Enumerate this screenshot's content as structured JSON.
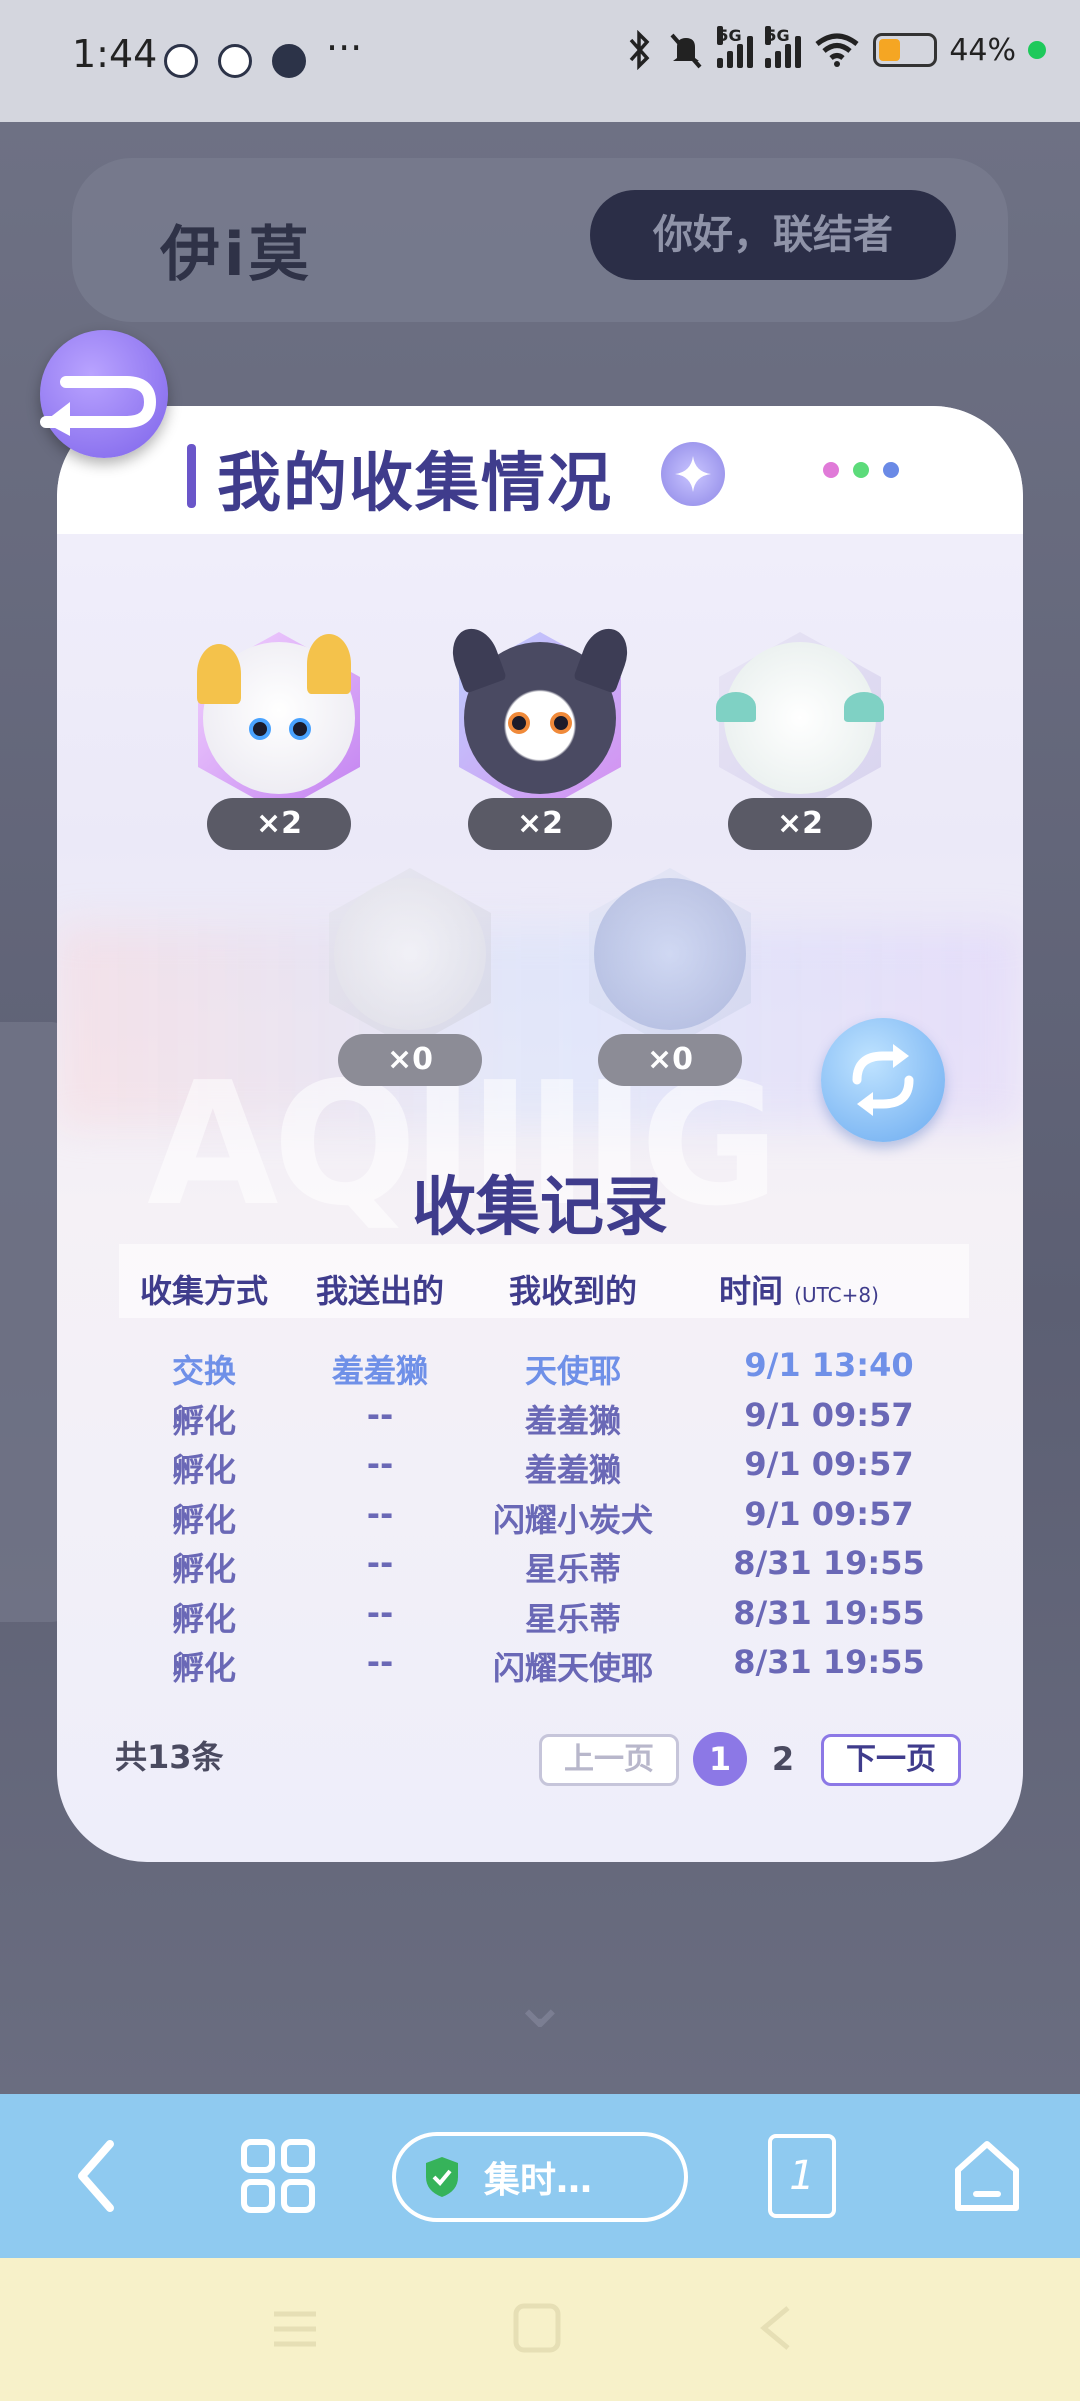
{
  "status_bar": {
    "time": "1:44",
    "more": "···",
    "network": "5G",
    "battery": "44%"
  },
  "background": {
    "logo": "伊i莫",
    "greeting": "你好，联结者"
  },
  "modal": {
    "title": "我的收集情况",
    "pets": [
      {
        "count": "×2"
      },
      {
        "count": "×2"
      },
      {
        "count": "×2"
      },
      {
        "count": "×0"
      },
      {
        "count": "×0"
      }
    ],
    "watermark": "AQIIIIG",
    "records_title": "收集记录",
    "columns": {
      "method": "收集方式",
      "sent": "我送出的",
      "received": "我收到的",
      "time": "时间",
      "tz": "(UTC+8)"
    },
    "rows": [
      {
        "method": "交换",
        "sent": "羞羞獭",
        "received": "天使耶",
        "time": "9/1 13:40"
      },
      {
        "method": "孵化",
        "sent": "--",
        "received": "羞羞獭",
        "time": "9/1 09:57"
      },
      {
        "method": "孵化",
        "sent": "--",
        "received": "羞羞獭",
        "time": "9/1 09:57"
      },
      {
        "method": "孵化",
        "sent": "--",
        "received": "闪耀小炭犬",
        "time": "9/1 09:57"
      },
      {
        "method": "孵化",
        "sent": "--",
        "received": "星乐蒂",
        "time": "8/31 19:55"
      },
      {
        "method": "孵化",
        "sent": "--",
        "received": "星乐蒂",
        "time": "8/31 19:55"
      },
      {
        "method": "孵化",
        "sent": "--",
        "received": "闪耀天使耶",
        "time": "8/31 19:55"
      }
    ],
    "total": "共13条",
    "prev": "上一页",
    "page1": "1",
    "page2": "2",
    "next": "下一页"
  },
  "browser": {
    "url_label": "集时…",
    "tab_count": "1"
  },
  "colors": {
    "accent": "#8c78e6",
    "title": "#3f3c8c",
    "toolbar": "#8fcaf0",
    "highlight_row": "#6f90e8"
  }
}
